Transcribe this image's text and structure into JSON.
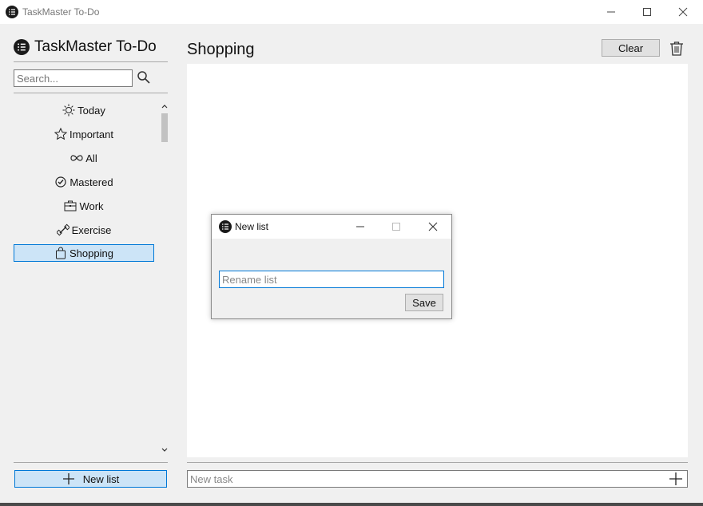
{
  "window": {
    "title": "TaskMaster To-Do",
    "icon": "app-logo-icon"
  },
  "sidebar": {
    "app_name": "TaskMaster To-Do",
    "search": {
      "placeholder": "Search...",
      "value": ""
    },
    "items": [
      {
        "label": "Today",
        "icon": "sun-icon"
      },
      {
        "label": "Important",
        "icon": "star-icon"
      },
      {
        "label": "All",
        "icon": "infinity-icon"
      },
      {
        "label": "Mastered",
        "icon": "check-circle-icon"
      },
      {
        "label": "Work",
        "icon": "briefcase-icon"
      },
      {
        "label": "Exercise",
        "icon": "dumbbell-icon"
      },
      {
        "label": "Shopping",
        "icon": "shopping-bag-icon",
        "selected": true
      }
    ],
    "new_list_label": "New list"
  },
  "main": {
    "title": "Shopping",
    "clear_label": "Clear",
    "new_task_placeholder": "New task"
  },
  "dialog": {
    "title": "New list",
    "input_placeholder": "Rename list",
    "input_value": "",
    "save_label": "Save"
  },
  "colors": {
    "selection_bg": "#cce4f7",
    "selection_border": "#0078d7",
    "window_bg": "#f0f0f0"
  }
}
